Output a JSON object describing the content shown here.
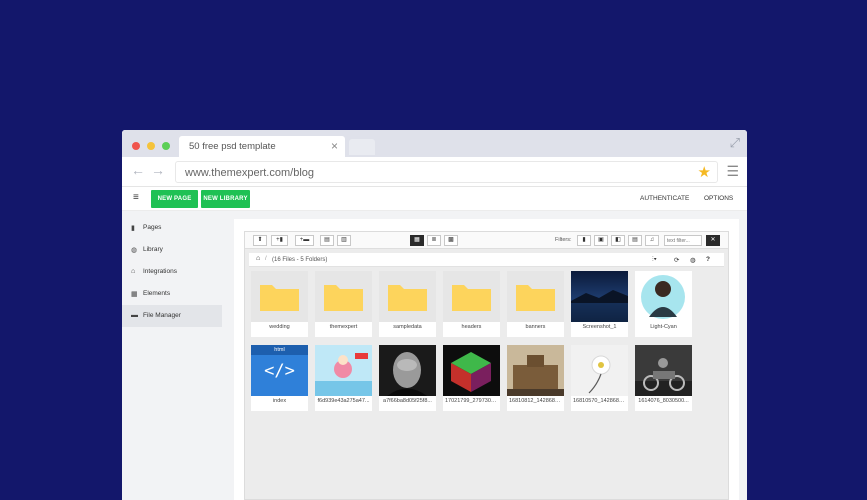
{
  "browser": {
    "tab_title": "50 free psd  template",
    "tab_close": "×",
    "url": "www.themexpert.com/blog",
    "back_glyph": "←",
    "forward_glyph": "→",
    "star_glyph": "★",
    "menu_glyph": "☰",
    "expand_glyph": "⤢"
  },
  "toolbar": {
    "menu_glyph": "≡",
    "new_page": "NEW PAGE",
    "new_library": "NEW LIBRARY",
    "authenticate": "AUTHENTICATE",
    "options": "OPTIONS"
  },
  "sidebar": {
    "items": [
      {
        "label": "Pages",
        "icon": "page-icon",
        "glyph": "▮"
      },
      {
        "label": "Library",
        "icon": "library-icon",
        "glyph": "◍"
      },
      {
        "label": "Integrations",
        "icon": "integrations-icon",
        "glyph": "⌂"
      },
      {
        "label": "Elements",
        "icon": "grid-icon",
        "glyph": "▦"
      },
      {
        "label": "File Manager",
        "icon": "folder-icon",
        "glyph": "▬",
        "active": true
      }
    ]
  },
  "file_manager": {
    "filters_label": "Filters:",
    "filter_placeholder": "text filter...",
    "clear_glyph": "✕",
    "home_glyph": "⌂",
    "path_separator": "/",
    "count": "(16 Files - 5 Folders)",
    "toolbar_glyphs": {
      "upload": "⬆",
      "new_file": "+▮",
      "new_folder": "+▬",
      "paste": "▤",
      "trash": "▥",
      "view_grid": "▦",
      "view_list": "≣",
      "view_tiles": "▩",
      "filter_file": "▮",
      "filter_image": "▣",
      "filter_archive": "◧",
      "filter_video": "▤",
      "filter_audio": "♫",
      "sort": "⫶▾",
      "refresh": "⟳",
      "globe": "◍",
      "help": "?"
    },
    "folders": [
      "wedding",
      "themexpert",
      "sampledata",
      "headers",
      "banners"
    ],
    "images_row1": [
      "Screenshot_1",
      "Light-Cyan"
    ],
    "row2": [
      "index",
      "f6d939e43a275a47...",
      "a7f66ba8d05f25f8...",
      "17021799_2797309...",
      "16810812_1428684...",
      "16810570_1428684...",
      "1614076_8030500..."
    ],
    "html_badge": "html",
    "html_symbol": "</>"
  },
  "colors": {
    "background": "#13176b",
    "accent_green": "#1fc154",
    "folder_yellow": "#fdd45c",
    "html_blue": "#2f80d9"
  }
}
